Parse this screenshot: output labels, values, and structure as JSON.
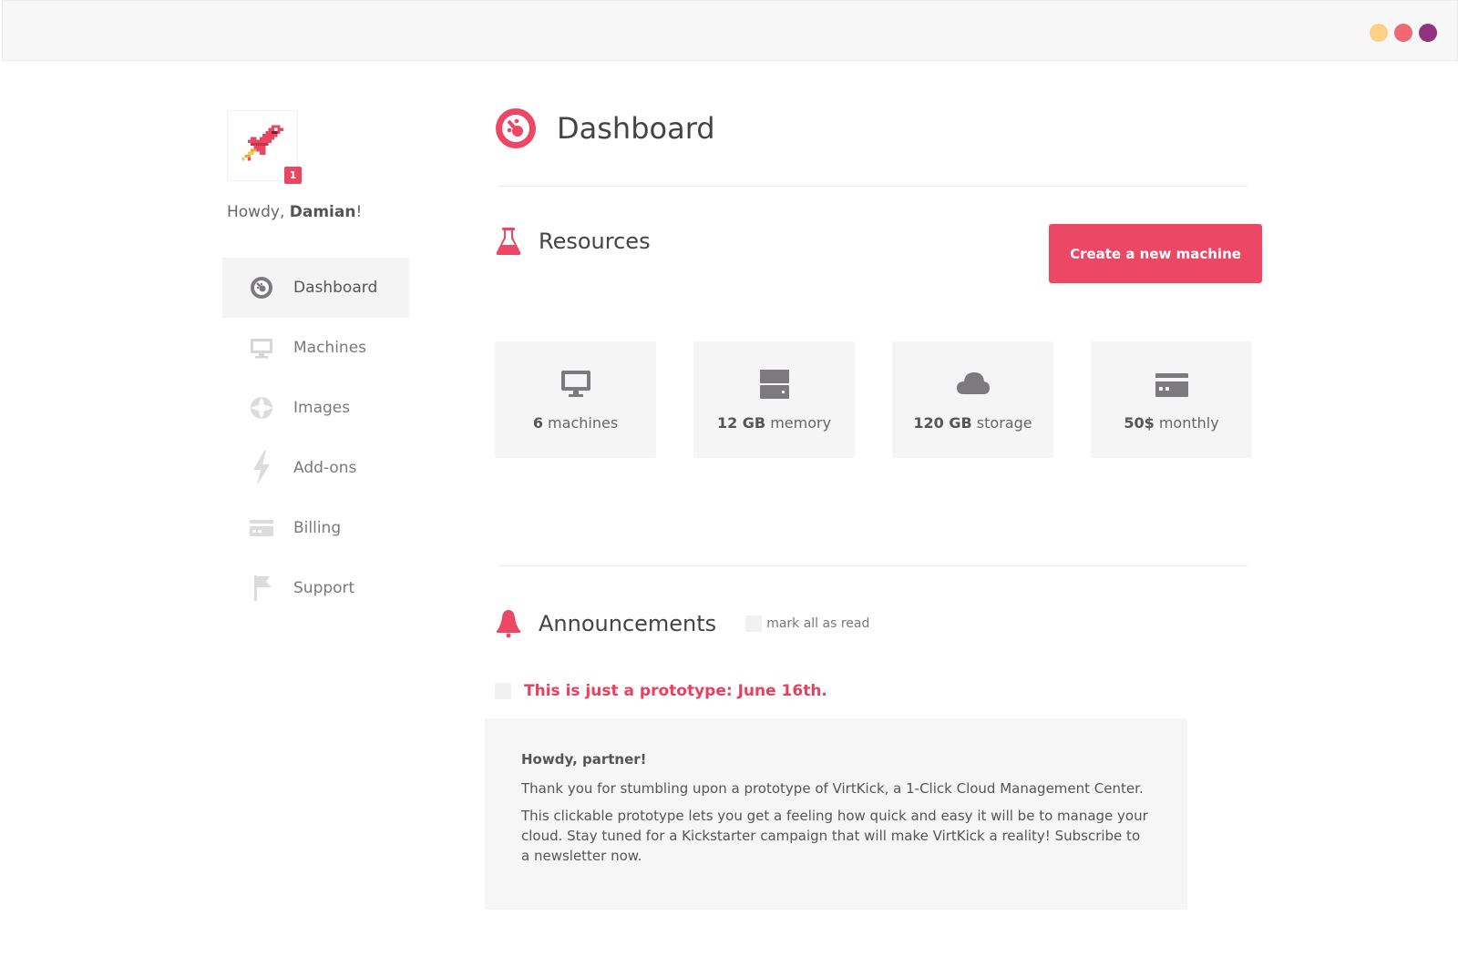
{
  "window": {
    "dots": [
      {
        "name": "yellow-dot",
        "color": "#fdd186"
      },
      {
        "name": "red-dot",
        "color": "#f06775"
      },
      {
        "name": "purple-dot",
        "color": "#92337d"
      }
    ]
  },
  "sidebar": {
    "badge_count": "1",
    "greeting_prefix": "Howdy, ",
    "user_name": "Damian",
    "greeting_suffix": "!",
    "items": [
      {
        "label": "Dashboard",
        "icon": "dashboard-icon",
        "active": true
      },
      {
        "label": "Machines",
        "icon": "monitor-icon",
        "active": false
      },
      {
        "label": "Images",
        "icon": "aperture-icon",
        "active": false
      },
      {
        "label": "Add-ons",
        "icon": "lightning-icon",
        "active": false
      },
      {
        "label": "Billing",
        "icon": "credit-card-icon",
        "active": false
      },
      {
        "label": "Support",
        "icon": "flag-icon",
        "active": false
      }
    ]
  },
  "main": {
    "title": "Dashboard",
    "resources": {
      "title": "Resources",
      "create_button": "Create a new machine",
      "stats": [
        {
          "value": "6",
          "label": " machines",
          "icon": "monitor-icon"
        },
        {
          "value": "12 GB",
          "label": " memory",
          "icon": "server-icon"
        },
        {
          "value": "120 GB",
          "label": " storage",
          "icon": "cloud-icon"
        },
        {
          "value": "50$",
          "label": " monthly",
          "icon": "credit-card-icon"
        }
      ]
    },
    "announcements": {
      "title": "Announcements",
      "mark_all": "mark all as read",
      "item_title": "This is just a prototype: June 16th.",
      "greeting": "Howdy, partner!",
      "paragraph1": "Thank you for stumbling upon a prototype of VirtKick, a 1-Click Cloud Management Center.",
      "paragraph2": "This clickable prototype lets you get a feeling how quick and easy it will be to manage your cloud. Stay tuned for a Kickstarter campaign that will make VirtKick a reality! Subscribe to a newsletter now."
    }
  },
  "colors": {
    "accent": "#ec4865",
    "icon_gray": "#7d7a7f",
    "icon_light": "#d6d6d6"
  }
}
